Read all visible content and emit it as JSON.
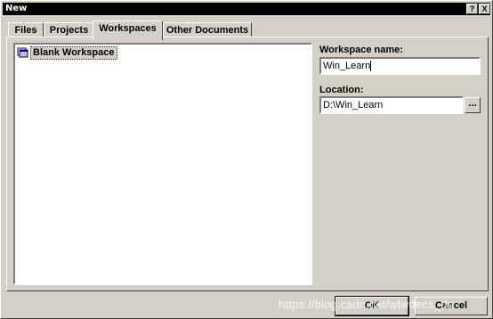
{
  "window": {
    "title": "New",
    "help_glyph": "?",
    "close_glyph": "X"
  },
  "tabs": [
    {
      "label": "Files"
    },
    {
      "label": "Projects"
    },
    {
      "label": "Workspaces",
      "active": true
    },
    {
      "label": "Other Documents"
    }
  ],
  "workspace_list": {
    "items": [
      {
        "label": "Blank Workspace",
        "icon": "blank-workspace-icon",
        "selected": true
      }
    ]
  },
  "form": {
    "workspace_name_label": "Workspace name:",
    "workspace_name_value": "Win_Learn",
    "location_label": "Location:",
    "location_value": "D:\\Win_Learn",
    "browse_label": "..."
  },
  "buttons": {
    "ok_label": "OK",
    "cancel_label": "Cancel"
  },
  "watermark": "https://blog.csdn.net/wlwdecs_dn",
  "colors": {
    "face": "#d4d0c8",
    "titlebar": "#000000",
    "highlight": "#ffffff",
    "shadow": "#404040"
  }
}
